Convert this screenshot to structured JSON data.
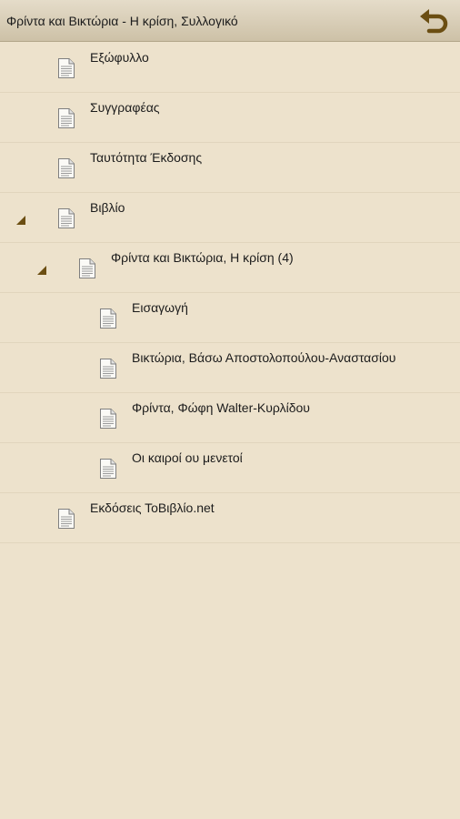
{
  "app": {
    "title": "Φρίντα και Βικτώρια - Η κρίση, Συλλογικό",
    "back_icon": "back-arrow-icon",
    "accent_color": "#6b4e12"
  },
  "toc": {
    "items": [
      {
        "label": "Εξώφυλλο",
        "level": 0,
        "expandable": false,
        "icon": "document-icon"
      },
      {
        "label": "Συγγραφέας",
        "level": 0,
        "expandable": false,
        "icon": "document-icon"
      },
      {
        "label": "Ταυτότητα Έκδοσης",
        "level": 0,
        "expandable": false,
        "icon": "document-icon"
      },
      {
        "label": "Βιβλίο",
        "level": 0,
        "expandable": true,
        "expanded": true,
        "icon": "document-icon"
      },
      {
        "label": "Φρίντα και Βικτώρια, Η κρίση (4)",
        "level": 1,
        "expandable": true,
        "expanded": true,
        "icon": "document-icon"
      },
      {
        "label": "Εισαγωγή",
        "level": 2,
        "expandable": false,
        "icon": "document-icon"
      },
      {
        "label": "Βικτώρια, Βάσω Αποστολοπούλου-Αναστασίου",
        "level": 2,
        "expandable": false,
        "icon": "document-icon"
      },
      {
        "label": "Φρίντα, Φώφη Walter-Κυρλίδου",
        "level": 2,
        "expandable": false,
        "icon": "document-icon"
      },
      {
        "label": "Οι καιροί ου μενετοί",
        "level": 2,
        "expandable": false,
        "icon": "document-icon"
      },
      {
        "label": "Εκδόσεις ΤοΒιβλίο.net",
        "level": 0,
        "expandable": false,
        "icon": "document-icon"
      }
    ]
  }
}
